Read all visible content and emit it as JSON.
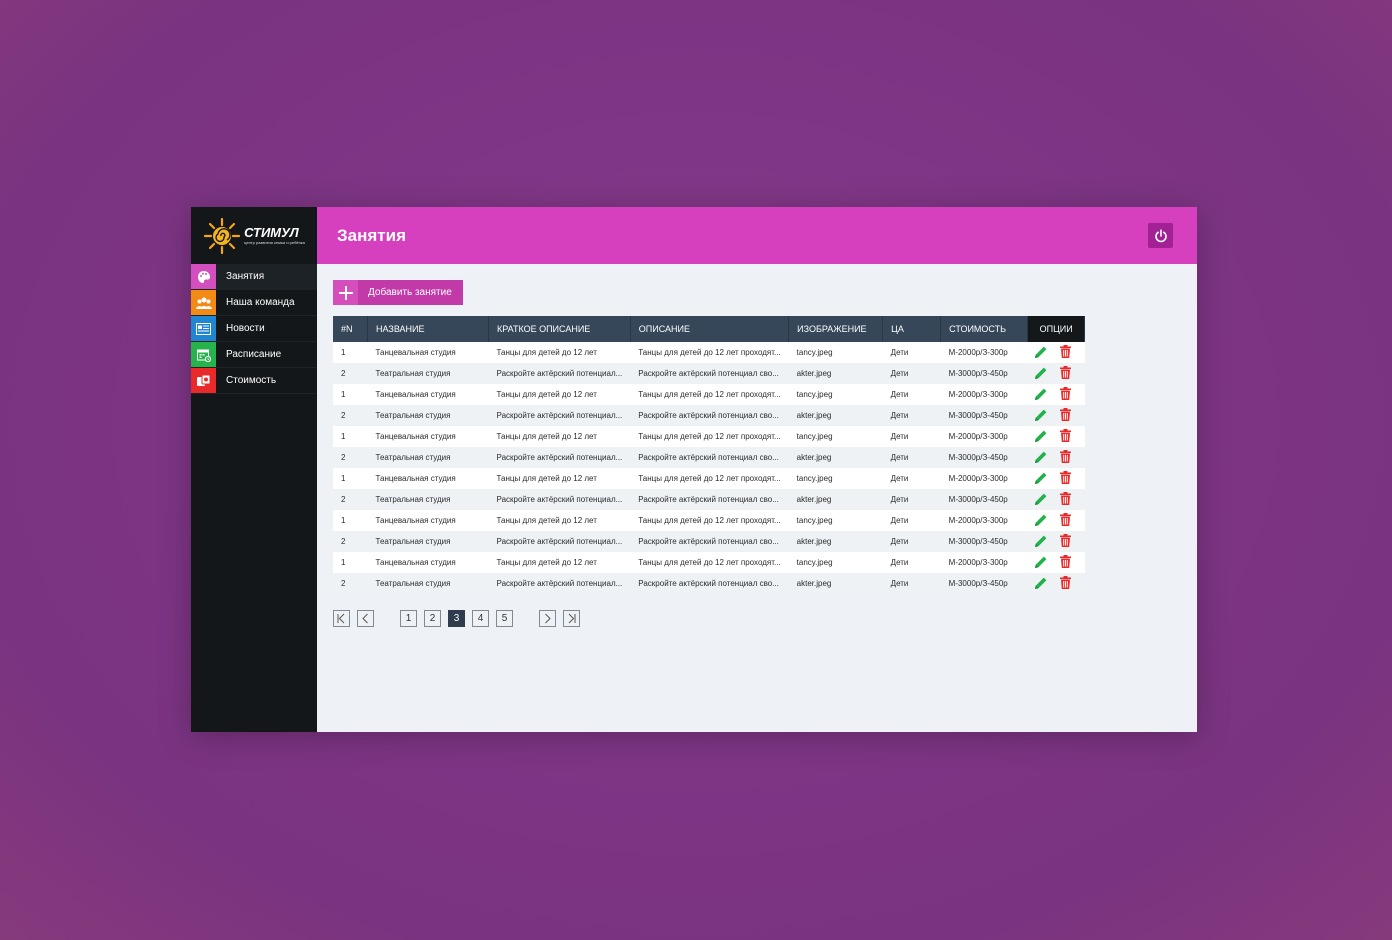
{
  "logo": {
    "title": "СТИМУЛ",
    "subtitle": "центр развития семьи и ребёнка"
  },
  "sidebar": {
    "items": [
      {
        "label": "Занятия",
        "icon": "palette-icon",
        "color": "#d34fc0",
        "active": true
      },
      {
        "label": "Наша команда",
        "icon": "team-icon",
        "color": "#f28a16",
        "active": false
      },
      {
        "label": "Новости",
        "icon": "news-icon",
        "color": "#1f86d2",
        "active": false
      },
      {
        "label": "Расписание",
        "icon": "calendar-icon",
        "color": "#27b34c",
        "active": false
      },
      {
        "label": "Стоимость",
        "icon": "price-icon",
        "color": "#ea2a2a",
        "active": false
      }
    ]
  },
  "header": {
    "title": "Занятия",
    "power_icon": "power-icon"
  },
  "colors": {
    "accent": "#d63fbd",
    "sidebar": "#131719",
    "table_header": "#36475a",
    "edit": "#22b14c",
    "delete": "#ea2a2a"
  },
  "toolbar": {
    "add_label": "Добавить занятие"
  },
  "table": {
    "columns": [
      "#N",
      "НАЗВАНИЕ",
      "КРАТКОЕ ОПИСАНИЕ",
      "ОПИСАНИЕ",
      "ИЗОБРАЖЕНИЕ",
      "ЦА",
      "СТОИМОСТЬ",
      "ОПЦИИ"
    ],
    "rows": [
      [
        "1",
        "Танцевальная студия",
        "Танцы для детей до 12 лет",
        "Танцы для детей до 12 лет проходят...",
        "tancy.jpeg",
        "Дети",
        "М-2000р/З-300р"
      ],
      [
        "2",
        "Театральная студия",
        "Раскройте актёрский потенциал...",
        "Раскройте актёрский потенциал сво...",
        "akter.jpeg",
        "Дети",
        "М-3000р/З-450р"
      ],
      [
        "1",
        "Танцевальная студия",
        "Танцы для детей до 12 лет",
        "Танцы для детей до 12 лет проходят...",
        "tancy.jpeg",
        "Дети",
        "М-2000р/З-300р"
      ],
      [
        "2",
        "Театральная студия",
        "Раскройте актёрский потенциал...",
        "Раскройте актёрский потенциал сво...",
        "akter.jpeg",
        "Дети",
        "М-3000р/З-450р"
      ],
      [
        "1",
        "Танцевальная студия",
        "Танцы для детей до 12 лет",
        "Танцы для детей до 12 лет проходят...",
        "tancy.jpeg",
        "Дети",
        "М-2000р/З-300р"
      ],
      [
        "2",
        "Театральная студия",
        "Раскройте актёрский потенциал...",
        "Раскройте актёрский потенциал сво...",
        "akter.jpeg",
        "Дети",
        "М-3000р/З-450р"
      ],
      [
        "1",
        "Танцевальная студия",
        "Танцы для детей до 12 лет",
        "Танцы для детей до 12 лет проходят...",
        "tancy.jpeg",
        "Дети",
        "М-2000р/З-300р"
      ],
      [
        "2",
        "Театральная студия",
        "Раскройте актёрский потенциал...",
        "Раскройте актёрский потенциал сво...",
        "akter.jpeg",
        "Дети",
        "М-3000р/З-450р"
      ],
      [
        "1",
        "Танцевальная студия",
        "Танцы для детей до 12 лет",
        "Танцы для детей до 12 лет проходят...",
        "tancy.jpeg",
        "Дети",
        "М-2000р/З-300р"
      ],
      [
        "2",
        "Театральная студия",
        "Раскройте актёрский потенциал...",
        "Раскройте актёрский потенциал сво...",
        "akter.jpeg",
        "Дети",
        "М-3000р/З-450р"
      ],
      [
        "1",
        "Танцевальная студия",
        "Танцы для детей до 12 лет",
        "Танцы для детей до 12 лет проходят...",
        "tancy.jpeg",
        "Дети",
        "М-2000р/З-300р"
      ],
      [
        "2",
        "Театральная студия",
        "Раскройте актёрский потенциал...",
        "Раскройте актёрский потенциал сво...",
        "akter.jpeg",
        "Дети",
        "М-3000р/З-450р"
      ]
    ],
    "row_actions": [
      "edit-icon",
      "delete-icon"
    ]
  },
  "pagination": {
    "pages": [
      "1",
      "2",
      "3",
      "4",
      "5"
    ],
    "current": "3",
    "nav_icons": [
      "first-page-icon",
      "prev-page-icon",
      "next-page-icon",
      "last-page-icon"
    ]
  }
}
